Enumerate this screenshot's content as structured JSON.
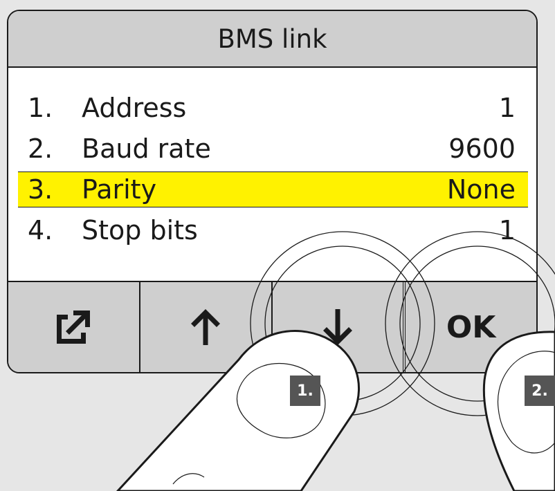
{
  "screen": {
    "title": "BMS link"
  },
  "menu": {
    "items": [
      {
        "num": "1.",
        "label": "Address",
        "value": "1"
      },
      {
        "num": "2.",
        "label": "Baud rate",
        "value": "9600"
      },
      {
        "num": "3.",
        "label": "Parity",
        "value": "None",
        "selected": true
      },
      {
        "num": "4.",
        "label": "Stop bits",
        "value": "1"
      }
    ]
  },
  "softkeys": [
    {
      "icon": "export-icon"
    },
    {
      "icon": "arrow-up-icon"
    },
    {
      "icon": "arrow-down-icon"
    },
    {
      "label": "OK"
    }
  ],
  "steps": [
    {
      "label": "1."
    },
    {
      "label": "2."
    }
  ],
  "colors": {
    "highlight": "#fff200",
    "panel": "#cfcfcf",
    "background": "#e6e6e6"
  }
}
